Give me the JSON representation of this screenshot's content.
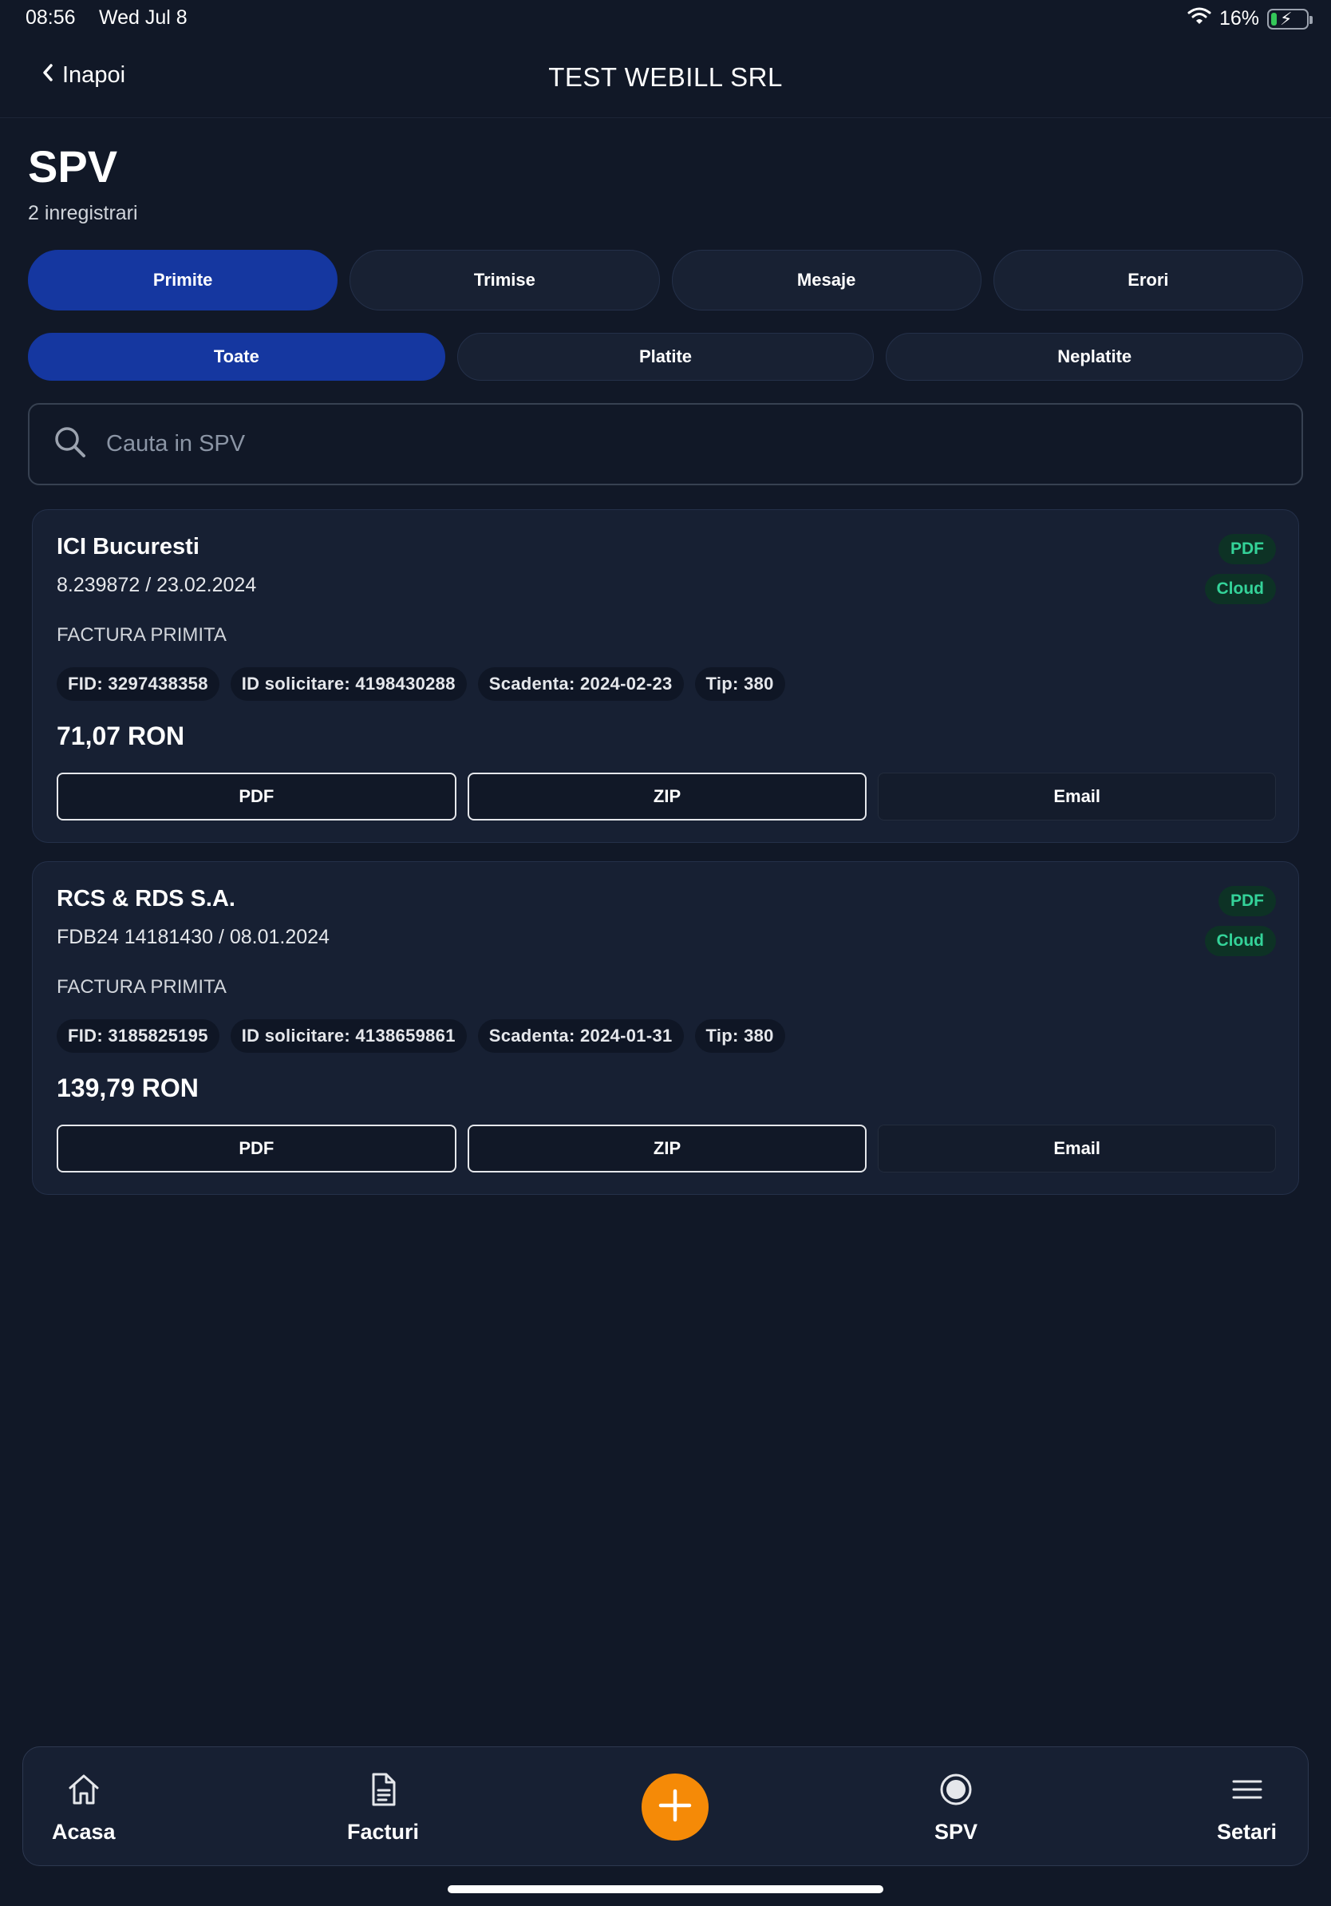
{
  "status_bar": {
    "time": "08:56",
    "date": "Wed Jul 8",
    "battery_percent": "16%",
    "battery_level": 0.16
  },
  "header": {
    "back_label": "Inapoi",
    "title": "TEST WEBILL SRL"
  },
  "page": {
    "title": "SPV",
    "record_count": "2 inregistrari"
  },
  "tabs": [
    {
      "label": "Primite",
      "active": true
    },
    {
      "label": "Trimise",
      "active": false
    },
    {
      "label": "Mesaje",
      "active": false
    },
    {
      "label": "Erori",
      "active": false
    }
  ],
  "filters": [
    {
      "label": "Toate",
      "active": true
    },
    {
      "label": "Platite",
      "active": false
    },
    {
      "label": "Neplatite",
      "active": false
    }
  ],
  "search": {
    "placeholder": "Cauta in SPV",
    "value": ""
  },
  "invoices": [
    {
      "company": "ICI Bucuresti",
      "number_date": "8.239872 / 23.02.2024",
      "type": "FACTURA PRIMITA",
      "badges": [
        "PDF",
        "Cloud"
      ],
      "chips": [
        "FID: 3297438358",
        "ID solicitare: 4198430288",
        "Scadenta: 2024-02-23",
        "Tip: 380"
      ],
      "amount": "71,07 RON",
      "actions": [
        "PDF",
        "ZIP",
        "Email"
      ]
    },
    {
      "company": "RCS & RDS S.A.",
      "number_date": "FDB24 14181430 / 08.01.2024",
      "type": "FACTURA PRIMITA",
      "badges": [
        "PDF",
        "Cloud"
      ],
      "chips": [
        "FID: 3185825195",
        "ID solicitare: 4138659861",
        "Scadenta: 2024-01-31",
        "Tip: 380"
      ],
      "amount": "139,79 RON",
      "actions": [
        "PDF",
        "ZIP",
        "Email"
      ]
    }
  ],
  "bottom_nav": {
    "items": [
      {
        "label": "Acasa",
        "icon": "home-icon"
      },
      {
        "label": "Facturi",
        "icon": "document-icon"
      },
      {
        "label": "SPV",
        "icon": "radio-icon"
      },
      {
        "label": "Setari",
        "icon": "menu-icon"
      }
    ],
    "fab_icon": "plus-icon"
  },
  "colors": {
    "background": "#111827",
    "card": "#172033",
    "active_tab": "#1537a0",
    "badge_bg": "#0d3225",
    "badge_text": "#34d399",
    "fab": "#f58a07",
    "battery": "#34c759"
  }
}
